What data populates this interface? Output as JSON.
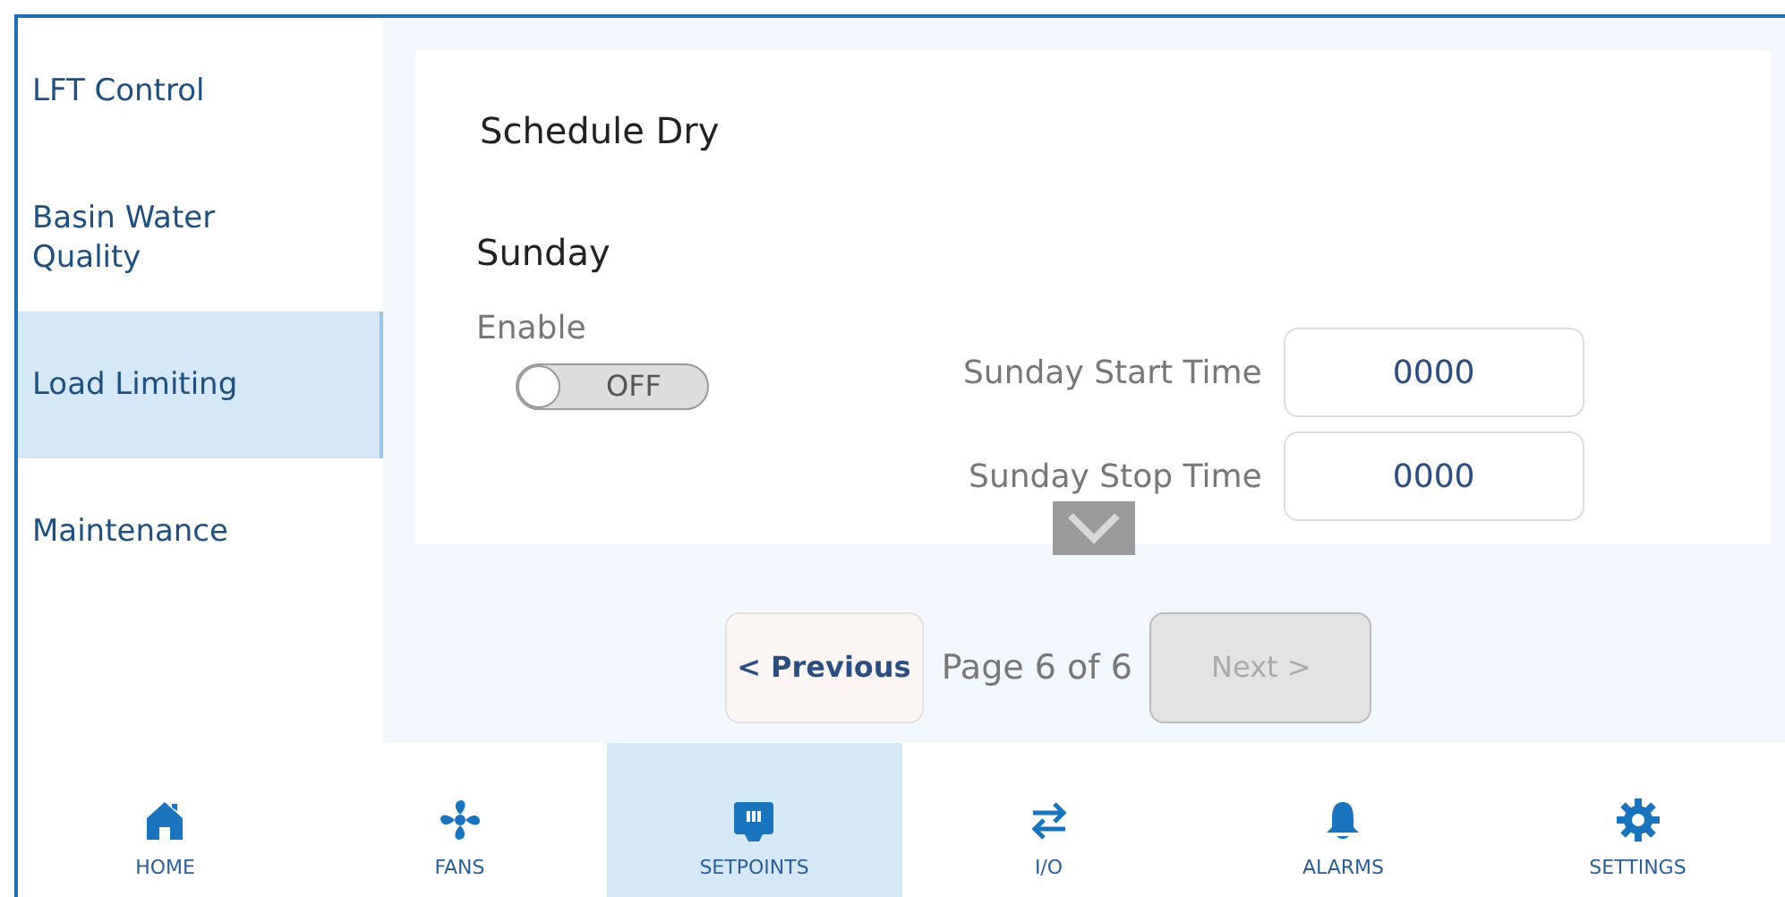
{
  "sidebar": {
    "items": [
      {
        "label": "LFT Control",
        "selected": false
      },
      {
        "label": "Basin Water Quality",
        "selected": false
      },
      {
        "label": "Load Limiting",
        "selected": true
      },
      {
        "label": "Maintenance",
        "selected": false
      }
    ]
  },
  "panel": {
    "title": "Schedule Dry",
    "day": "Sunday",
    "enable_label": "Enable",
    "toggle": {
      "on": false,
      "off_text": "OFF"
    },
    "fields": [
      {
        "label": "Sunday Start Time",
        "value": "0000"
      },
      {
        "label": "Sunday Stop Time",
        "value": "0000"
      }
    ]
  },
  "pager": {
    "previous": {
      "label": "< Previous",
      "disabled": false
    },
    "page": "Page 6 of 6",
    "next": {
      "label": "Next >",
      "disabled": true
    }
  },
  "nav": [
    {
      "label": "HOME",
      "selected": false
    },
    {
      "label": "FANS",
      "selected": false
    },
    {
      "label": "SETPOINTS",
      "selected": true
    },
    {
      "label": "I/O",
      "selected": false
    },
    {
      "label": "ALARMS",
      "selected": false
    },
    {
      "label": "SETTINGS",
      "selected": false
    }
  ]
}
